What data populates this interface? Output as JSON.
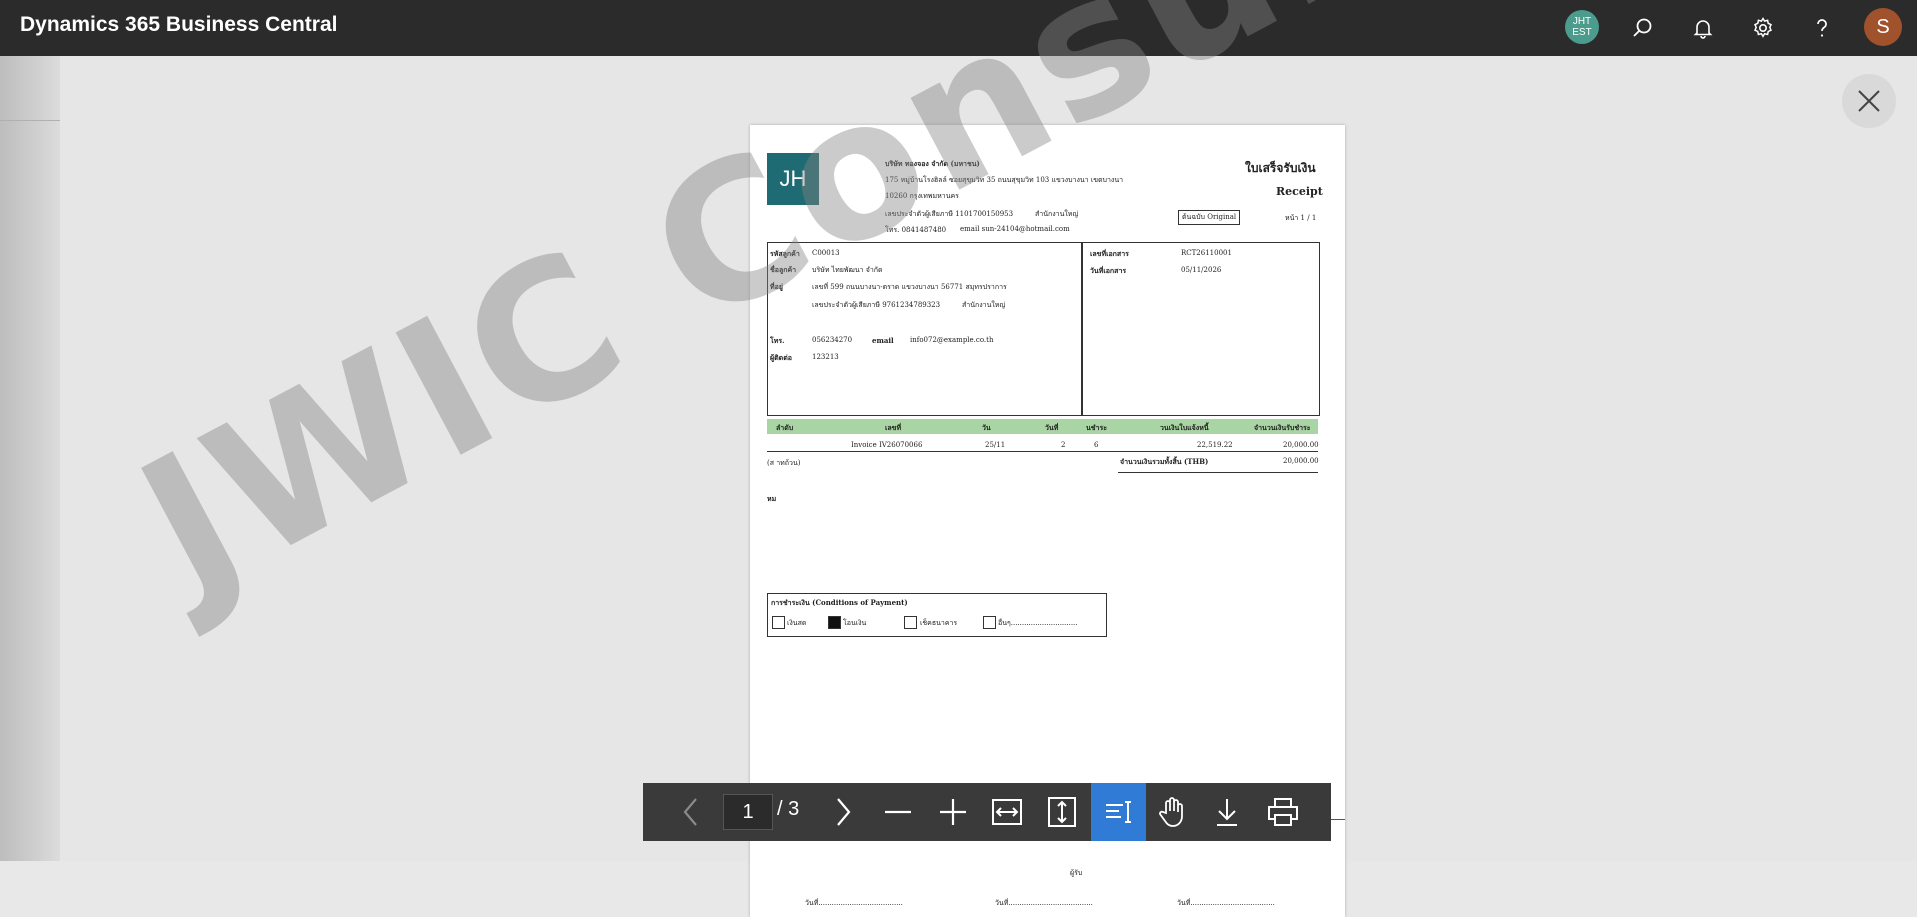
{
  "app": {
    "title": "Dynamics 365 Business Central"
  },
  "header": {
    "company_badge_line1": "JHT",
    "company_badge_line2": "EST",
    "avatar_initial": "S",
    "icons": [
      "search-icon",
      "bell-icon",
      "gear-icon",
      "help-icon"
    ]
  },
  "document": {
    "logo_text": "JH",
    "company_name": "บริษัท ทองจอง จำกัด (มหาชน)",
    "company_address_1": "175 หมู่บ้านโรงฮิลล์ ซอยสุขุมวิท 35 ถนนสุขุมวิท 103 แขวงบางนา เขตบางนา",
    "company_address_2": "10260 กรุงเทพมหานคร",
    "company_tax_label": "เลขประจำตัวผู้เสียภาษี 1101700150953",
    "company_branch": "สำนักงานใหญ่",
    "company_phone": "โทร. 0841487480",
    "company_email": "email sun-24104@hotmail.com",
    "doc_title_th": "ใบเสร็จรับเงิน",
    "doc_title_en": "Receipt",
    "original_badge": "ต้นฉบับ Original",
    "page_label": "หน้า 1 / 1",
    "customer_no_label": "รหัสลูกค้า",
    "customer_no": "C00013",
    "customer_name_label": "ชื่อลูกค้า",
    "customer_name": "บริษัท ไทยพัฒนา จำกัด",
    "address_label": "ที่อยู่",
    "address_line": "เลขที่ 599 ถนนบางนา-ตราด แขวงบางนา 56771 สมุทรปราการ",
    "customer_tax": "เลขประจำตัวผู้เสียภาษี 9761234789323",
    "customer_branch": "สำนักงานใหญ่",
    "phone_label": "โทร.",
    "phone": "056234270",
    "email_label": "email",
    "email": "info072@example.co.th",
    "contact_label": "ผู้ติดต่อ",
    "contact": "123213",
    "doc_no_label": "เลขที่เอกสาร",
    "doc_no": "RCT26110001",
    "doc_date_label": "วันที่เอกสาร",
    "doc_date": "05/11/2026",
    "table_headers": [
      "ลำดับ",
      "เลขที่",
      "วัน",
      "วันที่",
      "นชำระ",
      "วนเงินใบแจ้งหนี้",
      "จำนวนเงินรับชำระ"
    ],
    "row": {
      "doc": "Invoice IV26070066",
      "date": "25/11",
      "due": "2",
      "n": "6",
      "inv_amount": "22,519.22",
      "paid": "20,000.00"
    },
    "amount_words": "(ส         าทถ้วน)",
    "total_label": "จำนวนเงินรวมทั้งสิ้น (THB)",
    "total": "20,000.00",
    "note_label": "หม",
    "payment_title": "การชำระเงิน (Conditions of Payment)",
    "payment_cash": "เงินสด",
    "payment_transfer": "โอนเงิน",
    "payment_cheque": "เช็คธนาคาร",
    "payment_other": "อื่นๆ..............................",
    "sign_date_1": "วันที่......................................",
    "sign_date_2": "วันที่......................................",
    "sign_date_3": "วันที่......................................",
    "sign_fragment": "ผู้รับ"
  },
  "watermark": "JWIC Consulting",
  "viewer": {
    "current_page": "1",
    "total_pages": "/ 3"
  }
}
